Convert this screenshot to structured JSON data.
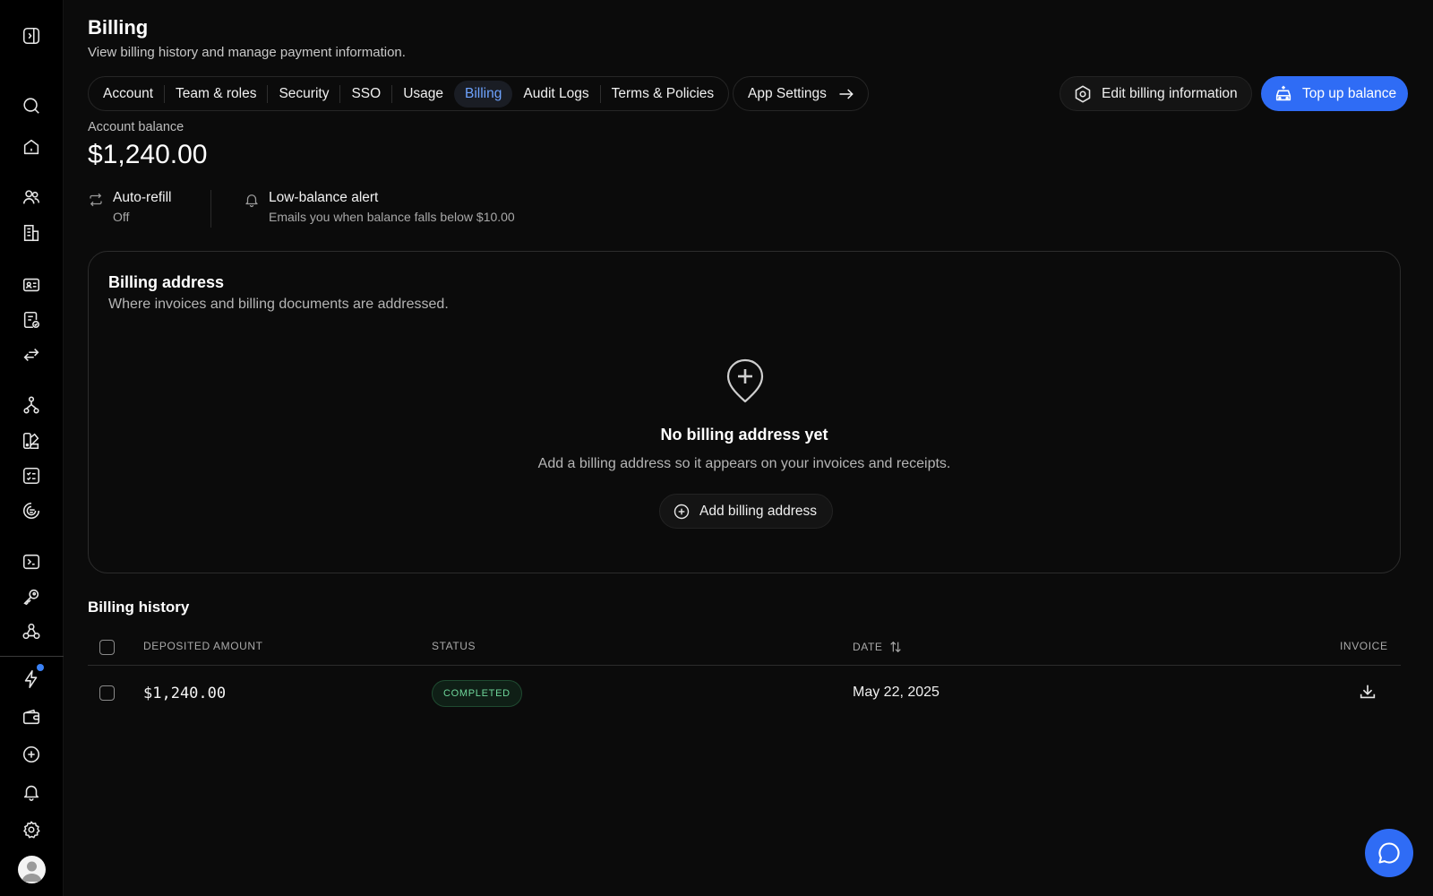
{
  "page": {
    "title": "Billing",
    "subtitle": "View billing history and manage payment information."
  },
  "sidebar": {
    "icons": [
      "sidebar-toggle-icon",
      "search-icon",
      "home-icon",
      "users-icon",
      "building-icon",
      "id-card-icon",
      "document-check-icon",
      "transfer-icon",
      "hierarchy-icon",
      "palette-icon",
      "checklist-icon",
      "shield-icon",
      "terminal-icon",
      "key-icon",
      "webhook-icon",
      "lightning-icon",
      "wallet-icon",
      "plus-circle-icon",
      "bell-icon",
      "gear-icon"
    ],
    "notification_dot_color": "#3b82f6"
  },
  "tabs": [
    {
      "label": "Account",
      "active": false
    },
    {
      "label": "Team & roles",
      "active": false
    },
    {
      "label": "Security",
      "active": false
    },
    {
      "label": "SSO",
      "active": false
    },
    {
      "label": "Usage",
      "active": false
    },
    {
      "label": "Billing",
      "active": true
    },
    {
      "label": "Audit Logs",
      "active": false
    },
    {
      "label": "Terms & Policies",
      "active": false
    }
  ],
  "app_settings_label": "App Settings",
  "actions": {
    "edit_billing": "Edit billing information",
    "top_up": "Top up balance"
  },
  "balance": {
    "label": "Account balance",
    "value": "$1,240.00"
  },
  "auto_refill": {
    "title": "Auto-refill",
    "value": "Off"
  },
  "low_balance": {
    "title": "Low-balance alert",
    "description": "Emails you when balance falls below $10.00"
  },
  "billing_address": {
    "title": "Billing address",
    "subtitle": "Where invoices and billing documents are addressed.",
    "empty_title": "No billing address yet",
    "empty_description": "Add a billing address so it appears on your invoices and receipts.",
    "add_button": "Add billing address"
  },
  "history": {
    "title": "Billing history",
    "columns": {
      "amount": "DEPOSITED AMOUNT",
      "status": "STATUS",
      "date": "DATE",
      "invoice": "INVOICE"
    },
    "rows": [
      {
        "amount": "$1,240.00",
        "status": "COMPLETED",
        "date": "May 22, 2025"
      }
    ]
  },
  "colors": {
    "accent": "#2f6cf5",
    "active_tab_text": "#6ea3ff",
    "status_completed": "#6fd79b"
  }
}
